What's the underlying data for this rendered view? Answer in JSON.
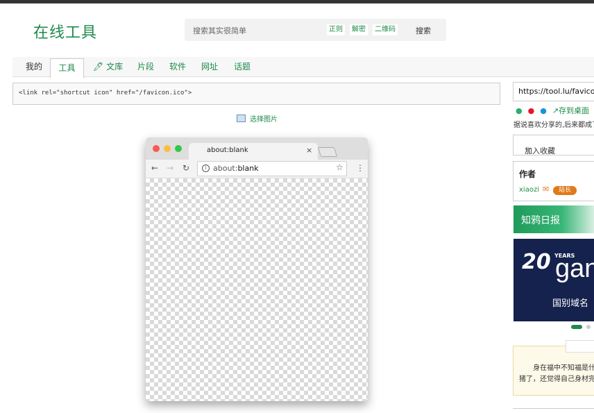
{
  "header": {
    "logo": "在线工具",
    "search_placeholder": "搜索其实很简单",
    "pills": [
      "正则",
      "解密",
      "二维码"
    ],
    "search_button": "搜索"
  },
  "nav": {
    "tabs": [
      "我的",
      "工具",
      "文库",
      "片段",
      "软件",
      "网址",
      "话题"
    ],
    "active": "工具"
  },
  "main": {
    "code": "<link rel=\"shortcut icon\" href=\"/favicon.ico\">",
    "pick_image": "选择图片"
  },
  "preview": {
    "tab_title": "about:blank",
    "tab_close": "×",
    "url_prefix": "about:",
    "url_bold": "blank"
  },
  "sidebar": {
    "url": "https://tool.lu/favicon",
    "share_save": "存到桌面",
    "share_text": "据说喜欢分享的,后来都成了大神",
    "favorite": "加入收藏",
    "author_title": "作者",
    "author_name": "xiaozi",
    "author_badge": "站长",
    "daily": "知鸦日报",
    "ad_years": "YEARS",
    "ad_twenty": "20",
    "ad_brand": "gan",
    "ad_sub": "国别域名",
    "note_line1": "身在福中不知福是什么",
    "note_line2": "猪了，还觉得自己身材完美"
  },
  "colors": {
    "accent": "#1e8a4c",
    "badge": "#e07a1a",
    "ad_bg": "#15224d"
  }
}
